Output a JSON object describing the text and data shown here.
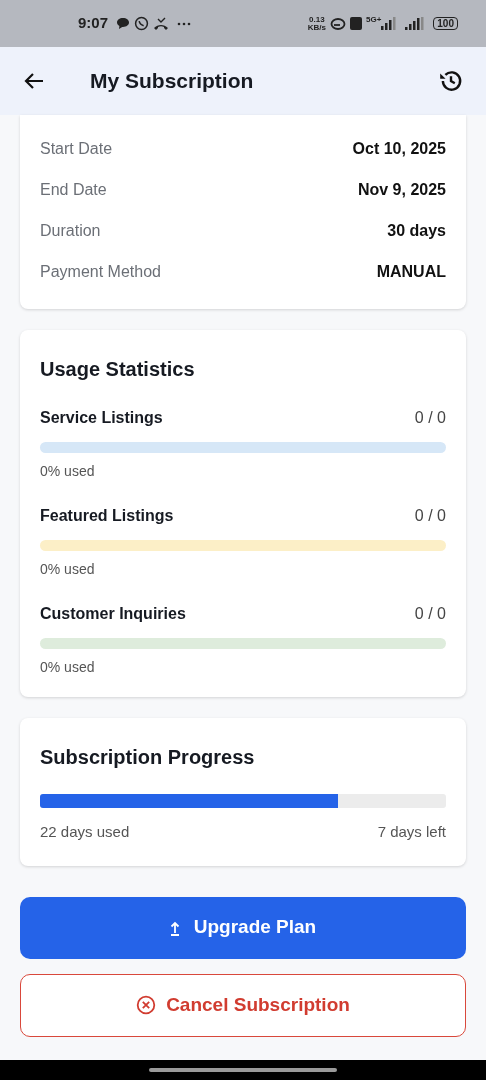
{
  "status_bar": {
    "time": "9:07",
    "speed_value": "0.13",
    "speed_unit": "KB/s",
    "network": "5G+",
    "battery": "100"
  },
  "header": {
    "title": "My Subscription"
  },
  "details": [
    {
      "label": "Start Date",
      "value": "Oct 10, 2025"
    },
    {
      "label": "End Date",
      "value": "Nov 9, 2025"
    },
    {
      "label": "Duration",
      "value": "30 days"
    },
    {
      "label": "Payment Method",
      "value": "MANUAL"
    }
  ],
  "usage": {
    "title": "Usage Statistics",
    "items": [
      {
        "name": "Service Listings",
        "count": "0 / 0",
        "level": 0,
        "color": "#d6e7f7",
        "caption": "0% used"
      },
      {
        "name": "Featured Listings",
        "count": "0 / 0",
        "level": 0,
        "color": "#fcefc7",
        "caption": "0% used"
      },
      {
        "name": "Customer Inquiries",
        "count": "0 / 0",
        "level": 0,
        "color": "#deecdc",
        "caption": "0% used"
      }
    ]
  },
  "progress": {
    "title": "Subscription Progress",
    "level": 0.735,
    "used": "22 days used",
    "left": "7 days left"
  },
  "buttons": {
    "upgrade": "Upgrade Plan",
    "cancel": "Cancel Subscription"
  }
}
